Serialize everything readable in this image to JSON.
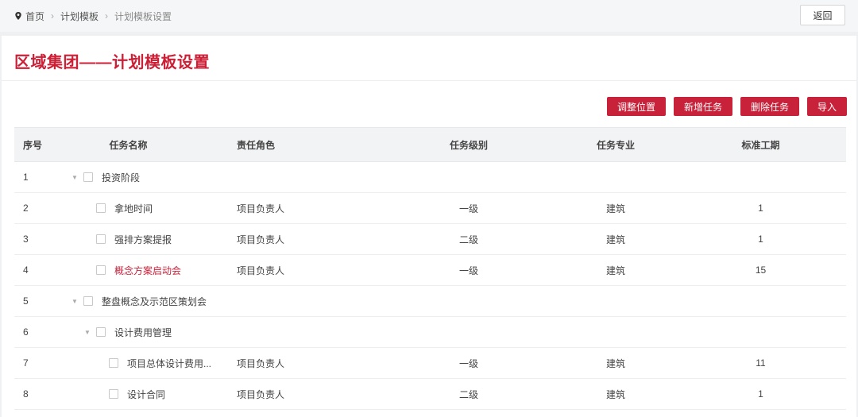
{
  "breadcrumb": {
    "home": "首页",
    "level1": "计划模板",
    "level2": "计划模板设置"
  },
  "back_label": "返回",
  "page_title": "区域集团——计划模板设置",
  "actions": {
    "adjust": "调整位置",
    "add": "新增任务",
    "delete": "删除任务",
    "import": "导入"
  },
  "columns": {
    "idx": "序号",
    "name": "任务名称",
    "role": "责任角色",
    "level": "任务级别",
    "major": "任务专业",
    "period": "标准工期"
  },
  "rows": [
    {
      "idx": "1",
      "name": "投资阶段",
      "role": "",
      "level": "",
      "major": "",
      "period": ""
    },
    {
      "idx": "2",
      "name": "拿地时间",
      "role": "项目负责人",
      "level": "一级",
      "major": "建筑",
      "period": "1"
    },
    {
      "idx": "3",
      "name": "强排方案提报",
      "role": "项目负责人",
      "level": "二级",
      "major": "建筑",
      "period": "1"
    },
    {
      "idx": "4",
      "name": "概念方案启动会",
      "role": "项目负责人",
      "level": "一级",
      "major": "建筑",
      "period": "15"
    },
    {
      "idx": "5",
      "name": "整盘概念及示范区策划会",
      "role": "",
      "level": "",
      "major": "",
      "period": ""
    },
    {
      "idx": "6",
      "name": "设计费用管理",
      "role": "",
      "level": "",
      "major": "",
      "period": ""
    },
    {
      "idx": "7",
      "name": "项目总体设计费用...",
      "role": "项目负责人",
      "level": "一级",
      "major": "建筑",
      "period": "11"
    },
    {
      "idx": "8",
      "name": "设计合同",
      "role": "项目负责人",
      "level": "二级",
      "major": "建筑",
      "period": "1"
    }
  ],
  "colors": {
    "accent": "#c8213a",
    "title": "#cc1f36"
  },
  "icons": {
    "location": "location-pin-icon",
    "expand": "caret-down-icon"
  }
}
